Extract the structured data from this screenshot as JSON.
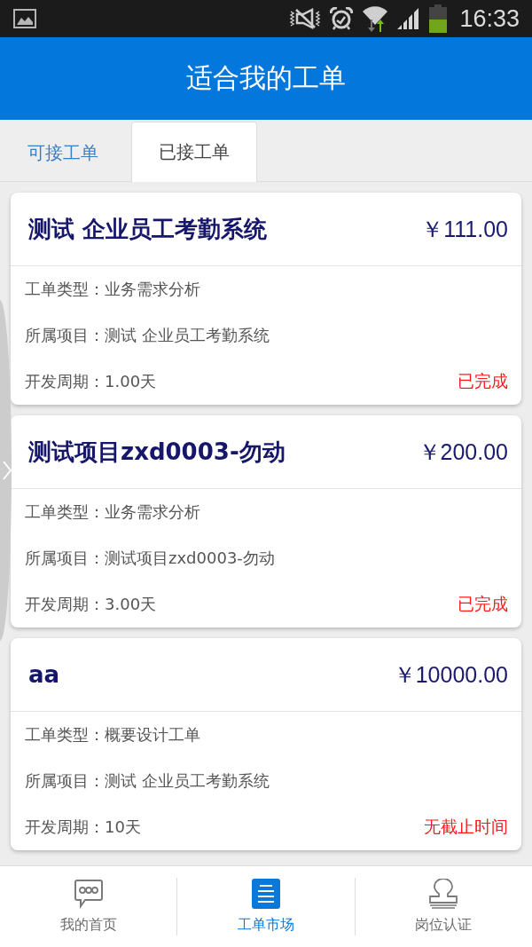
{
  "status_bar": {
    "time": "16:33"
  },
  "header": {
    "title": "适合我的工单"
  },
  "tabs": [
    {
      "label": "可接工单",
      "selected": false
    },
    {
      "label": "已接工单",
      "selected": true
    }
  ],
  "orders": [
    {
      "title": "测试 企业员工考勤系统",
      "price": "￥111.00",
      "details": [
        "工单类型：业务需求分析",
        "所属项目：测试 企业员工考勤系统",
        "开发周期：1.00天"
      ],
      "status": "已完成"
    },
    {
      "title": "测试项目zxd0003-勿动",
      "price": "￥200.00",
      "details": [
        "工单类型：业务需求分析",
        "所属项目：测试项目zxd0003-勿动",
        "开发周期：3.00天"
      ],
      "status": "已完成"
    },
    {
      "title": "aa",
      "price": "￥10000.00",
      "details": [
        "工单类型：概要设计工单",
        "所属项目：测试 企业员工考勤系统",
        "开发周期：10天"
      ],
      "status": "无截止时间"
    }
  ],
  "bottom_nav": {
    "items": [
      {
        "label": "我的首页",
        "selected": false
      },
      {
        "label": "工单市场",
        "selected": true
      },
      {
        "label": "岗位认证",
        "selected": false
      }
    ]
  }
}
